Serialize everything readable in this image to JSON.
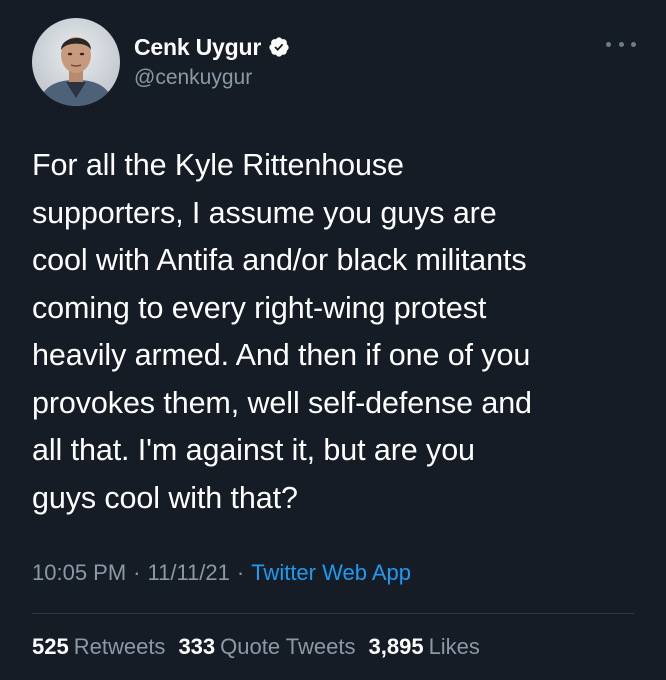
{
  "user": {
    "display_name": "Cenk Uygur",
    "handle": "@cenkuygur",
    "verified_icon": "verified-badge-icon",
    "avatar_icon": "avatar"
  },
  "tweet": {
    "text": "For all the Kyle Rittenhouse\nsupporters, I assume you guys are\ncool with Antifa and/or black militants\ncoming to every right-wing protest\nheavily armed. And then if one of you\nprovokes them, well self-defense and\nall that. I'm against it, but are you\nguys cool with that?"
  },
  "meta": {
    "time": "10:05 PM",
    "separator": "·",
    "date": "11/11/21",
    "source": "Twitter Web App"
  },
  "stats": {
    "retweets_count": "525",
    "retweets_label": "Retweets",
    "quotes_count": "333",
    "quotes_label": "Quote Tweets",
    "likes_count": "3,895",
    "likes_label": "Likes"
  },
  "colors": {
    "background": "#151c26",
    "text": "#ffffff",
    "secondary": "#8b98a5",
    "link": "#1d9bf0",
    "verified": "#ffffff"
  }
}
